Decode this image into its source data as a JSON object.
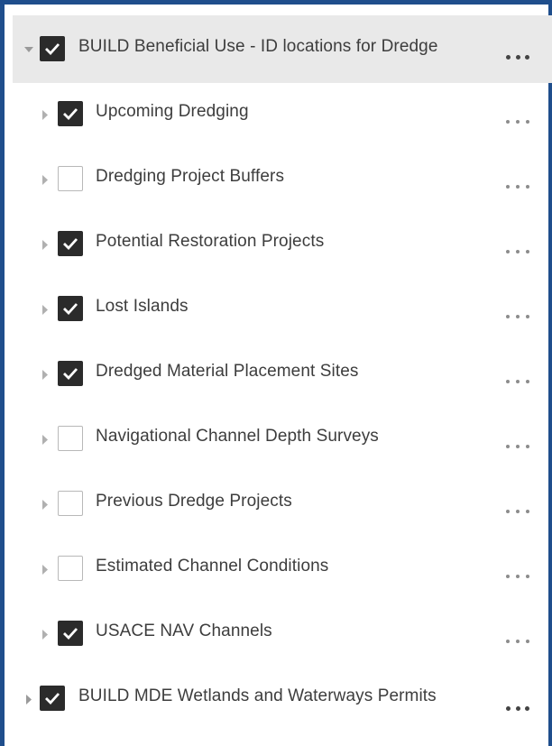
{
  "layers": {
    "group1": {
      "label": "BUILD Beneficial Use - ID locations for Dredge",
      "checked": true,
      "expanded": true,
      "arrow_icon": "caret-down-icon",
      "children": [
        {
          "label": "Upcoming Dredging",
          "checked": true
        },
        {
          "label": "Dredging Project Buffers",
          "checked": false
        },
        {
          "label": "Potential Restoration Projects",
          "checked": true
        },
        {
          "label": "Lost Islands",
          "checked": true
        },
        {
          "label": "Dredged Material Placement Sites",
          "checked": true
        },
        {
          "label": "Navigational Channel Depth Surveys",
          "checked": false
        },
        {
          "label": "Previous Dredge Projects",
          "checked": false
        },
        {
          "label": "Estimated Channel Conditions",
          "checked": false
        },
        {
          "label": "USACE NAV Channels",
          "checked": true
        }
      ]
    },
    "group2": {
      "label": "BUILD MDE Wetlands and Waterways Permits",
      "checked": true,
      "expanded": false,
      "arrow_icon": "caret-right-icon"
    }
  },
  "icons": {
    "options": "more-options-icon",
    "check": "checkmark-icon",
    "collapsed": "caret-right-icon"
  },
  "colors": {
    "frame_border": "#1f4e8c",
    "header_background": "#e9e9e9",
    "checkbox_checked": "#2b2b2b"
  }
}
